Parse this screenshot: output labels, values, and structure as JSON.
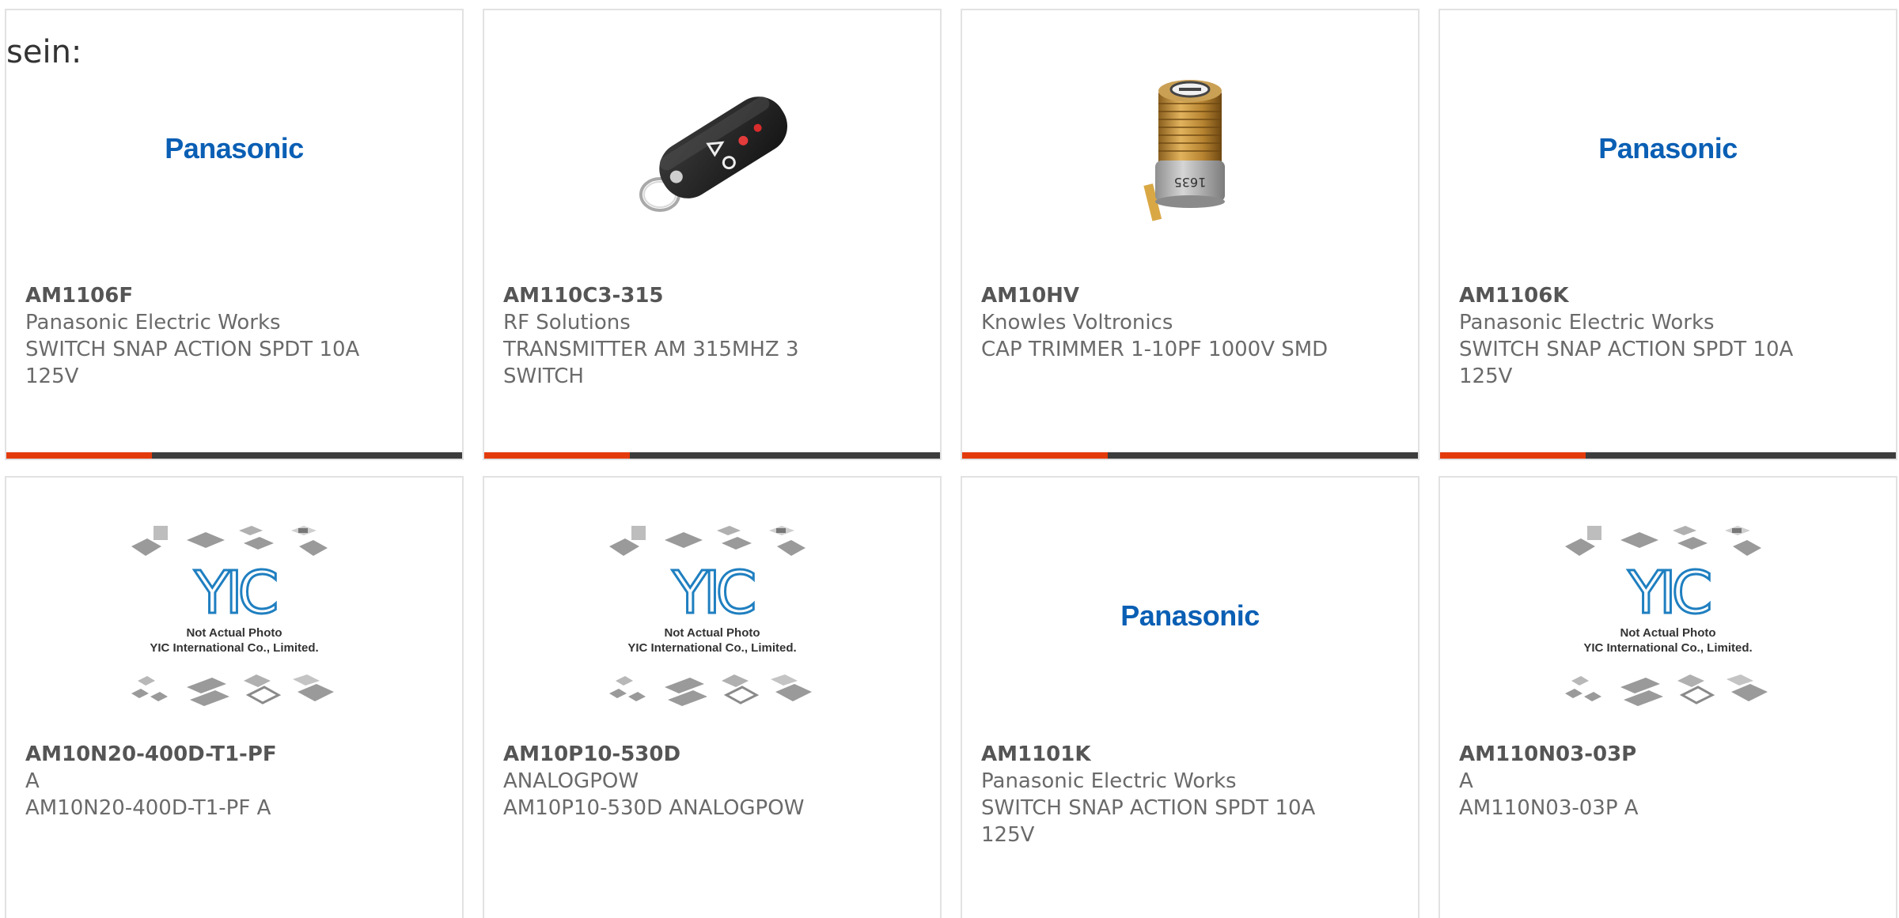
{
  "intro_text": "sein:",
  "yic_caption": {
    "line1": "Not Actual Photo",
    "line2": "YIC International Co., Limited."
  },
  "products": [
    {
      "part_number": "AM1106F",
      "manufacturer": "Panasonic Electric Works",
      "description": "SWITCH SNAP ACTION SPDT 10A 125V",
      "image": "panasonic-logo",
      "image_text": "Panasonic"
    },
    {
      "part_number": "AM110C3-315",
      "manufacturer": "RF Solutions",
      "description": "TRANSMITTER AM 315MHZ 3 SWITCH",
      "image": "remote-transmitter-photo"
    },
    {
      "part_number": "AM10HV",
      "manufacturer": "Knowles Voltronics",
      "description": "CAP TRIMMER 1-10PF 1000V SMD",
      "image": "trimmer-capacitor-photo"
    },
    {
      "part_number": "AM1106K",
      "manufacturer": "Panasonic Electric Works",
      "description": "SWITCH SNAP ACTION SPDT 10A 125V",
      "image": "panasonic-logo",
      "image_text": "Panasonic"
    },
    {
      "part_number": "AM10N20-400D-T1-PF",
      "manufacturer": "A",
      "description": "AM10N20-400D-T1-PF A",
      "image": "yic-placeholder"
    },
    {
      "part_number": "AM10P10-530D",
      "manufacturer": "ANALOGPOW",
      "description": "AM10P10-530D ANALOGPOW",
      "image": "yic-placeholder"
    },
    {
      "part_number": "AM1101K",
      "manufacturer": "Panasonic Electric Works",
      "description": "SWITCH SNAP ACTION SPDT 10A 125V",
      "image": "panasonic-logo",
      "image_text": "Panasonic"
    },
    {
      "part_number": "AM110N03-03P",
      "manufacturer": "A",
      "description": "AM110N03-03P A",
      "image": "yic-placeholder"
    }
  ],
  "colors": {
    "accent": "#e33b0c",
    "bar_dark": "#3d3d3d",
    "card_border": "#e2e2e2",
    "panasonic_blue": "#0a5fb4",
    "yic_blue": "#1f7fc0",
    "text_gray": "#6a6a6a"
  }
}
